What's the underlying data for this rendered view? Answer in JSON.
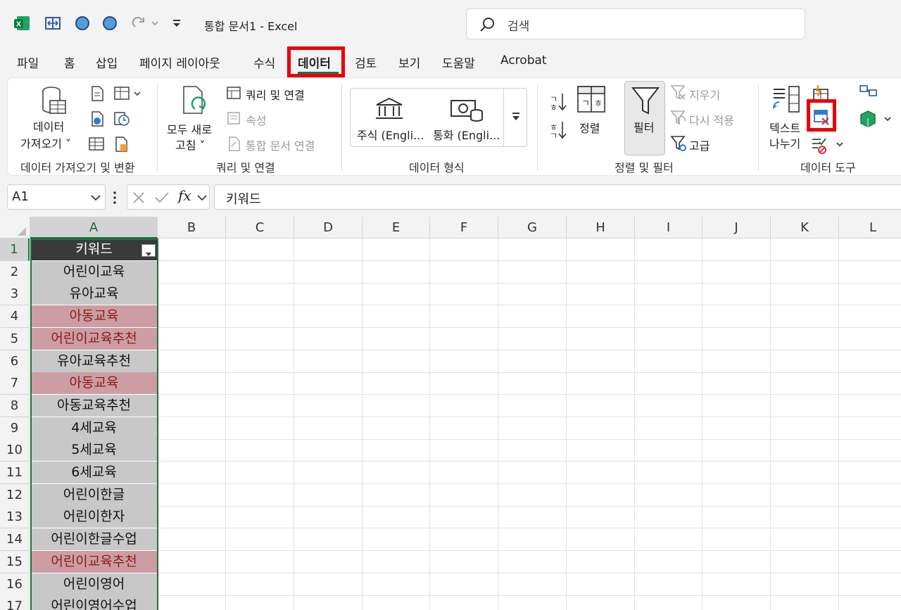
{
  "title_bar": {
    "doc_title": "통합 문서1  -  Excel",
    "search_placeholder": "검색"
  },
  "tabs": [
    {
      "label": "파일"
    },
    {
      "label": "홈"
    },
    {
      "label": "삽입"
    },
    {
      "label": "페이지 레이아웃"
    },
    {
      "label": "수식"
    },
    {
      "label": "데이터",
      "active": true
    },
    {
      "label": "검토"
    },
    {
      "label": "보기"
    },
    {
      "label": "도움말"
    },
    {
      "label": "Acrobat"
    }
  ],
  "ribbon": {
    "get_data": {
      "line1": "데이터",
      "line2": "가져오기 ˅"
    },
    "group1_label": "데이터 가져오기 및 변환",
    "refresh_all": {
      "line1": "모두 새로",
      "line2": "고침 ˅"
    },
    "queries_connections": "쿼리 및 연결",
    "properties": "속성",
    "workbook_links": "통합 문서 연결",
    "group2_label": "쿼리 및 연결",
    "stocks": "주식 (Engli...",
    "currencies": "통화 (Engli...",
    "group3_label": "데이터 형식",
    "sort": "정렬",
    "filter": "필터",
    "clear": "지우기",
    "reapply": "다시 적용",
    "advanced": "고급",
    "group4_label": "정렬 및 필터",
    "text_to_columns": {
      "line1": "텍스트",
      "line2": "나누기"
    },
    "group5_label": "데이터 도구"
  },
  "formula_bar": {
    "name_box": "A1",
    "fx": "fx",
    "formula": "키워드"
  },
  "columns": [
    "A",
    "B",
    "C",
    "D",
    "E",
    "F",
    "G",
    "H",
    "I",
    "J",
    "K",
    "L"
  ],
  "rows": [
    {
      "num": "1",
      "value": "키워드",
      "style": "header"
    },
    {
      "num": "2",
      "value": "어린이교육",
      "style": "normal"
    },
    {
      "num": "3",
      "value": "유아교육",
      "style": "normal"
    },
    {
      "num": "4",
      "value": "아동교육",
      "style": "duplicate"
    },
    {
      "num": "5",
      "value": "어린이교육추천",
      "style": "duplicate"
    },
    {
      "num": "6",
      "value": "유아교육추천",
      "style": "normal"
    },
    {
      "num": "7",
      "value": "아동교육",
      "style": "duplicate"
    },
    {
      "num": "8",
      "value": "아동교육추천",
      "style": "normal"
    },
    {
      "num": "9",
      "value": "4세교육",
      "style": "normal"
    },
    {
      "num": "10",
      "value": "5세교육",
      "style": "normal"
    },
    {
      "num": "11",
      "value": "6세교육",
      "style": "normal"
    },
    {
      "num": "12",
      "value": "어린이한글",
      "style": "normal"
    },
    {
      "num": "13",
      "value": "어린이한자",
      "style": "normal"
    },
    {
      "num": "14",
      "value": "어린이한글수업",
      "style": "normal"
    },
    {
      "num": "15",
      "value": "어린이교육추천",
      "style": "duplicate"
    },
    {
      "num": "16",
      "value": "어린이영어",
      "style": "normal"
    },
    {
      "num": "17",
      "value": "어린이영어수업",
      "style": "normal"
    }
  ],
  "colors": {
    "excel_green": "#1e7145",
    "highlight_red": "#e8000b",
    "duplicate_fill": "#cc9ea3",
    "duplicate_text": "#8b1a1a"
  }
}
